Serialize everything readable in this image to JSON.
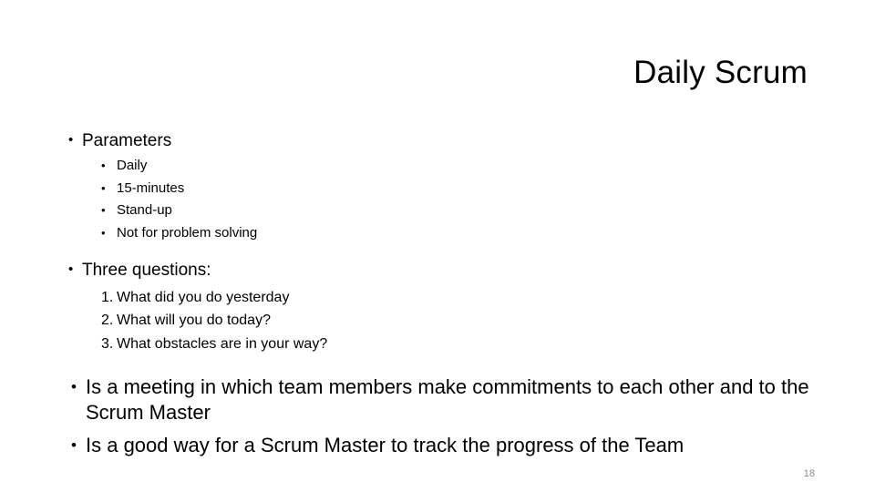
{
  "slide": {
    "title": "Daily Scrum",
    "page_number": "18",
    "bullet_glyph": "•",
    "sections": {
      "parameters": {
        "heading": "Parameters",
        "items": [
          "Daily",
          "15-minutes",
          "Stand-up",
          "Not for problem solving"
        ]
      },
      "three_questions": {
        "heading": "Three questions:",
        "items": [
          {
            "number": "1.",
            "text": "What did you do yesterday"
          },
          {
            "number": "2.",
            "text": "What will you do today?"
          },
          {
            "number": "3.",
            "text": "What obstacles are in your way?"
          }
        ]
      },
      "statements": [
        "Is a meeting in which team members make commitments to each other and to the Scrum Master",
        "Is a good way for a Scrum Master to track the progress of the Team"
      ]
    }
  }
}
